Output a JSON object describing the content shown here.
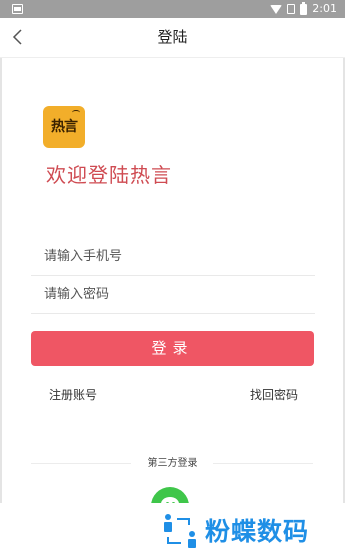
{
  "status_bar": {
    "time": "2:01",
    "icons": [
      "app-icon",
      "wifi-icon",
      "sim-icon",
      "battery-icon"
    ]
  },
  "nav": {
    "title": "登陆",
    "back_icon": "chevron-left-icon"
  },
  "logo": {
    "text": "热言"
  },
  "welcome_text": "欢迎登陆热言",
  "form": {
    "phone_placeholder": "请输入手机号",
    "password_placeholder": "请输入密码",
    "login_label": "登录"
  },
  "links": {
    "register": "注册账号",
    "forgot": "找回密码"
  },
  "third_party": {
    "label": "第三方登录",
    "providers": [
      "wechat-icon"
    ]
  },
  "watermark": {
    "text": "粉蝶数码"
  },
  "colors": {
    "accent": "#ef5664",
    "welcome": "#cf4b52",
    "logo_bg": "#f2ae2a",
    "wechat": "#3fc64a",
    "watermark": "#1f8fe6"
  }
}
